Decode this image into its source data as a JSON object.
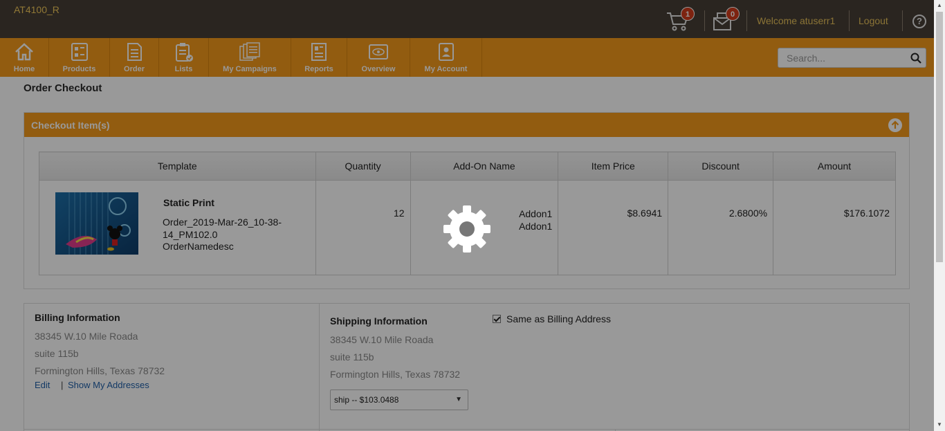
{
  "header": {
    "app_id": "AT4100_R",
    "cart_count": "1",
    "messages_count": "0",
    "welcome": "Welcome atuserr1",
    "logout": "Logout",
    "help": "?"
  },
  "nav": {
    "items": [
      {
        "label": "Home",
        "icon": "home-icon"
      },
      {
        "label": "Products",
        "icon": "products-icon"
      },
      {
        "label": "Order",
        "icon": "order-icon"
      },
      {
        "label": "Lists",
        "icon": "lists-icon"
      },
      {
        "label": "My Campaigns",
        "icon": "campaigns-icon"
      },
      {
        "label": "Reports",
        "icon": "reports-icon"
      },
      {
        "label": "Overview",
        "icon": "overview-icon"
      },
      {
        "label": "My Account",
        "icon": "account-icon"
      }
    ],
    "search_placeholder": "Search..."
  },
  "page": {
    "title": "Order Checkout"
  },
  "checkout": {
    "panel_title": "Checkout Item(s)",
    "columns": [
      "Template",
      "Quantity",
      "Add-On Name",
      "Item Price",
      "Discount",
      "Amount"
    ],
    "row": {
      "template_name": "Static Print",
      "order_name": "Order_2019-Mar-26_10-38-14_PM102.0",
      "order_desc": "OrderNamedesc",
      "quantity": "12",
      "addon_1": "Addon1",
      "addon_2": "Addon1",
      "item_price": "$8.6941",
      "discount": "2.6800%",
      "amount": "$176.1072"
    }
  },
  "billing": {
    "title": "Billing Information",
    "line1": "38345 W.10 Mile Roada",
    "line2": "suite 115b",
    "line3": "Formington Hills, Texas 78732",
    "edit": "Edit",
    "separator": "|",
    "show_addresses": "Show My Addresses"
  },
  "shipping": {
    "title": "Shipping Information",
    "same_as_billing": "Same as Billing Address",
    "same_checked": true,
    "line1": "38345 W.10 Mile Roada",
    "line2": "suite 115b",
    "line3": "Formington Hills, Texas 78732",
    "method": "ship -- $103.0488"
  },
  "colors": {
    "topbar": "#463e36",
    "nav": "#f39a1b",
    "accent_text": "#e8c25a",
    "badge": "#d13b1b"
  }
}
